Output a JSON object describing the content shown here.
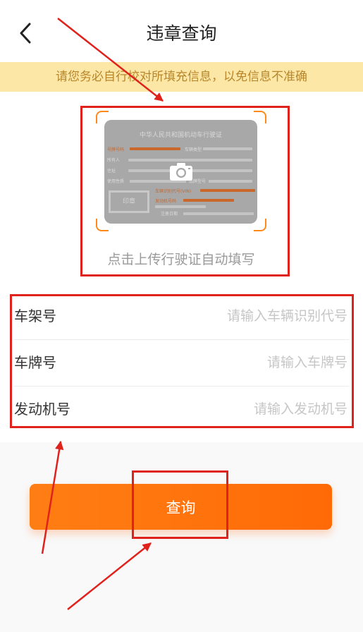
{
  "header": {
    "title": "违章查询",
    "back_icon": "chevron-left-icon"
  },
  "notice": {
    "text": "请您务必自行校对所填充信息，以免信息不准确"
  },
  "upload": {
    "text": "点击上传行驶证自动填写",
    "license": {
      "title": "中华人民共和国机动车行驶证",
      "labels": [
        "号牌号码",
        "车辆类型",
        "所有人",
        "住址",
        "使用性质",
        "品牌型号",
        "车辆识别代号(VIN)",
        "发动机号码",
        "注册日期",
        "印章"
      ]
    },
    "icon": "camera-icon",
    "accent": "#ff8a1a"
  },
  "form": {
    "fields": [
      {
        "label": "车架号",
        "placeholder": "请输入车辆识别代号",
        "value": ""
      },
      {
        "label": "车牌号",
        "placeholder": "请输入车牌号",
        "value": ""
      },
      {
        "label": "发动机号",
        "placeholder": "请输入发动机号",
        "value": ""
      }
    ]
  },
  "actions": {
    "query_label": "查询"
  },
  "colors": {
    "primary": "#ff7010",
    "notice_bg": "#fde7a6",
    "notice_text": "#b8862a",
    "annotation": "#e0221c"
  }
}
